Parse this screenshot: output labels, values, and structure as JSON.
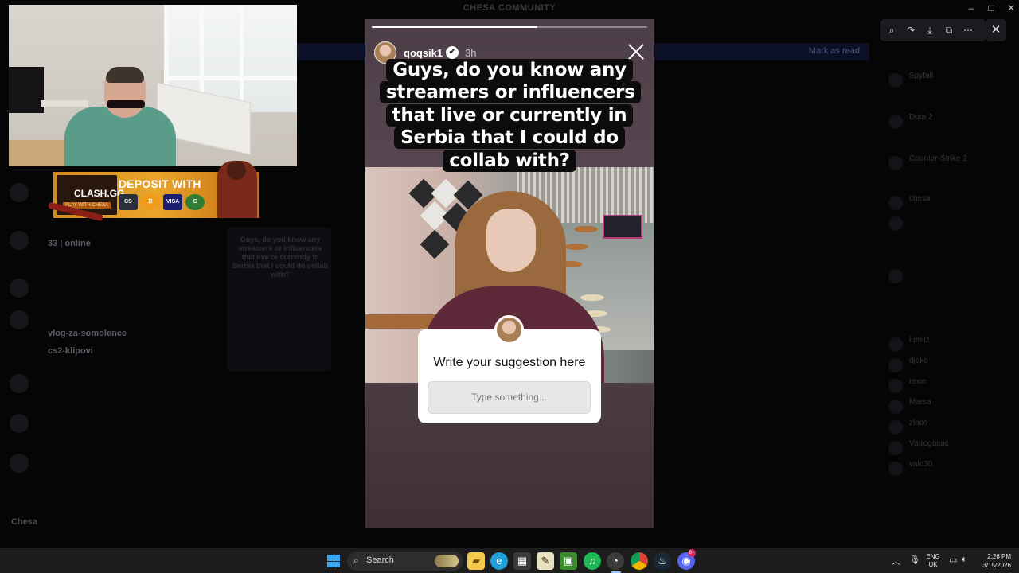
{
  "window": {
    "title": "CHESA COMMUNITY",
    "controls": [
      "–",
      "□",
      "✕"
    ]
  },
  "background": {
    "notification": "Mark as read",
    "channels": [
      {
        "name": "33 | online",
        "bold": true
      },
      {
        "name": "",
        "bold": false
      },
      {
        "name": "",
        "bold": false
      },
      {
        "name": "",
        "bold": false
      },
      {
        "name": "",
        "bold": false
      },
      {
        "name": "vlog-za-somolence",
        "bold": true
      },
      {
        "name": "cs2-klipovi",
        "bold": true
      }
    ],
    "user": "Chesa",
    "chat_preview": "Guys, do you know any streamers or influencers that live or currently in Serbia that I could do collab with?",
    "members": [
      "Spyfall",
      "Dota 2",
      "Counter-Strike 2",
      "chesa",
      "",
      "",
      "lumiiz",
      "djoko",
      "rexie",
      "Marsa",
      "zloco",
      "Vatrogasac",
      "valo30"
    ]
  },
  "viewer": {
    "tools": [
      "zoom-icon",
      "forward-icon",
      "download-icon",
      "open-external-icon",
      "more-icon"
    ],
    "close": "✕"
  },
  "sponsor": {
    "brand": "CLASH.GG",
    "brand_sub": "PLAY WITH CHESA",
    "headline": "DEPOSIT WITH",
    "methods": [
      {
        "label": "CS",
        "color": "#2b2f3a"
      },
      {
        "label": "₿",
        "color": "#f29a1a"
      },
      {
        "label": "VISA",
        "color": "#1a1f71"
      },
      {
        "label": "G",
        "color": "#2e7d32"
      }
    ]
  },
  "story": {
    "username": "qoqsik1",
    "verified": "✔",
    "time": "3h",
    "progress": 0.6,
    "caption": "Guys, do you know any streamers or influencers that live or currently in Serbia that I could do collab with?",
    "question": {
      "title": "Write your suggestion here",
      "placeholder": "Type something..."
    }
  },
  "taskbar": {
    "search_label": "Search",
    "apps": [
      {
        "name": "file-explorer-icon",
        "glyph": "▰",
        "color": "#f2c94c"
      },
      {
        "name": "edge-icon",
        "glyph": "e",
        "color": "#1fa0d8"
      },
      {
        "name": "store-icon",
        "glyph": "▦",
        "color": "#3a3a3a"
      },
      {
        "name": "app-icon",
        "glyph": "✎",
        "color": "#2b2b2b"
      },
      {
        "name": "minecraft-icon",
        "glyph": "▣",
        "color": "#3d8b2f"
      },
      {
        "name": "spotify-icon",
        "glyph": "♫",
        "color": "#1db954"
      },
      {
        "name": "recording-app-icon",
        "glyph": "◔",
        "color": "#3a3a3a"
      },
      {
        "name": "chrome-icon",
        "glyph": "●",
        "color": "#db4437"
      },
      {
        "name": "steam-icon",
        "glyph": "♨",
        "color": "#1b2838"
      },
      {
        "name": "discord-icon",
        "glyph": "◉",
        "color": "#5865f2"
      }
    ],
    "discord_badge": "9+",
    "language_top": "ENG",
    "language_bottom": "UK",
    "time": "2:26 PM",
    "date": "3/15/2026"
  }
}
